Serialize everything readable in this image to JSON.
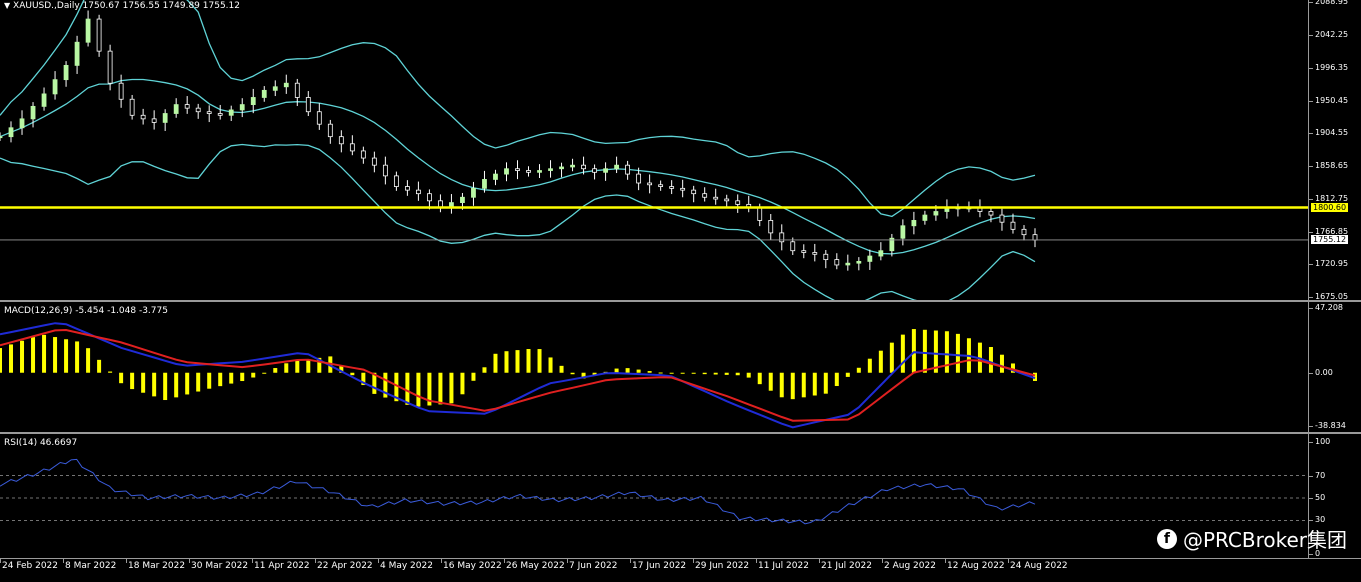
{
  "price_pane": {
    "header": "XAUUSD.,Daily  1750.67 1756.55 1749.89 1755.12",
    "axis_ticks": [
      "2088.95",
      "2042.25",
      "1996.35",
      "1950.45",
      "1904.55",
      "1858.65",
      "1812.75",
      "1766.85",
      "1720.95",
      "1675.05"
    ],
    "line_price_label": "1800.60",
    "last_price_label": "1755.12",
    "line_color": "#ffff00"
  },
  "macd_pane": {
    "header": "MACD(12,26,9) -5.454 -1.048 -3.775",
    "axis_ticks": [
      "47.208",
      "0.00",
      "-38.834"
    ]
  },
  "rsi_pane": {
    "header": "RSI(14) 46.6697",
    "axis_ticks": [
      "100",
      "70",
      "50",
      "30",
      "0"
    ]
  },
  "date_axis": {
    "labels": [
      "24 Feb 2022",
      "8 Mar 2022",
      "18 Mar 2022",
      "30 Mar 2022",
      "11 Apr 2022",
      "22 Apr 2022",
      "4 May 2022",
      "16 May 2022",
      "26 May 2022",
      "7 Jun 2022",
      "17 Jun 2022",
      "29 Jun 2022",
      "11 Jul 2022",
      "21 Jul 2022",
      "2 Aug 2022",
      "12 Aug 2022",
      "24 Aug 2022"
    ]
  },
  "watermark": {
    "text": "@PRCBroker集团",
    "icon": "facebook-icon"
  },
  "chart_data": [
    {
      "type": "candlestick",
      "title": "XAUUSD., Daily",
      "ylim": [
        1675.05,
        2088.95
      ],
      "horizontal_line": 1800.6,
      "last": {
        "open": 1750.67,
        "high": 1756.55,
        "low": 1749.89,
        "close": 1755.12
      },
      "close_path": [
        1900,
        1925,
        1960,
        2000,
        2065,
        1975,
        1930,
        1920,
        1945,
        1935,
        1930,
        1945,
        1965,
        1975,
        1935,
        1900,
        1880,
        1860,
        1830,
        1820,
        1800,
        1815,
        1840,
        1855,
        1850,
        1855,
        1860,
        1850,
        1860,
        1835,
        1830,
        1825,
        1815,
        1810,
        1800,
        1765,
        1740,
        1735,
        1720,
        1725,
        1740,
        1775,
        1790,
        1800,
        1800,
        1790,
        1770,
        1755
      ],
      "overlays": [
        "Bollinger upper",
        "Bollinger middle",
        "Bollinger lower"
      ]
    },
    {
      "type": "bar",
      "title": "MACD(12,26,9)",
      "ylim": [
        -38.834,
        47.208
      ],
      "values": [
        18,
        28,
        22,
        -10,
        -20,
        -12,
        -5,
        8,
        12,
        -15,
        -25,
        -22,
        15,
        18,
        -5,
        4,
        0,
        -1,
        -2,
        -20,
        -15,
        10,
        32,
        30,
        18,
        -6
      ],
      "series": [
        {
          "name": "MACD",
          "values": [
            28,
            37,
            18,
            5,
            8,
            15,
            -8,
            -28,
            -30,
            -8,
            0,
            -2,
            -22,
            -40,
            -30,
            15,
            12,
            -4
          ]
        },
        {
          "name": "Signal",
          "values": [
            20,
            32,
            22,
            8,
            4,
            10,
            2,
            -20,
            -28,
            -15,
            -5,
            -3,
            -18,
            -35,
            -34,
            0,
            10,
            -2
          ]
        }
      ]
    },
    {
      "type": "line",
      "title": "RSI(14)",
      "ylim": [
        0,
        100
      ],
      "reference_levels": [
        70,
        50,
        30
      ],
      "values": [
        62,
        72,
        85,
        58,
        50,
        52,
        50,
        54,
        65,
        55,
        42,
        48,
        45,
        46,
        52,
        48,
        50,
        55,
        48,
        50,
        32,
        30,
        28,
        44,
        58,
        62,
        58,
        40,
        46
      ]
    }
  ]
}
